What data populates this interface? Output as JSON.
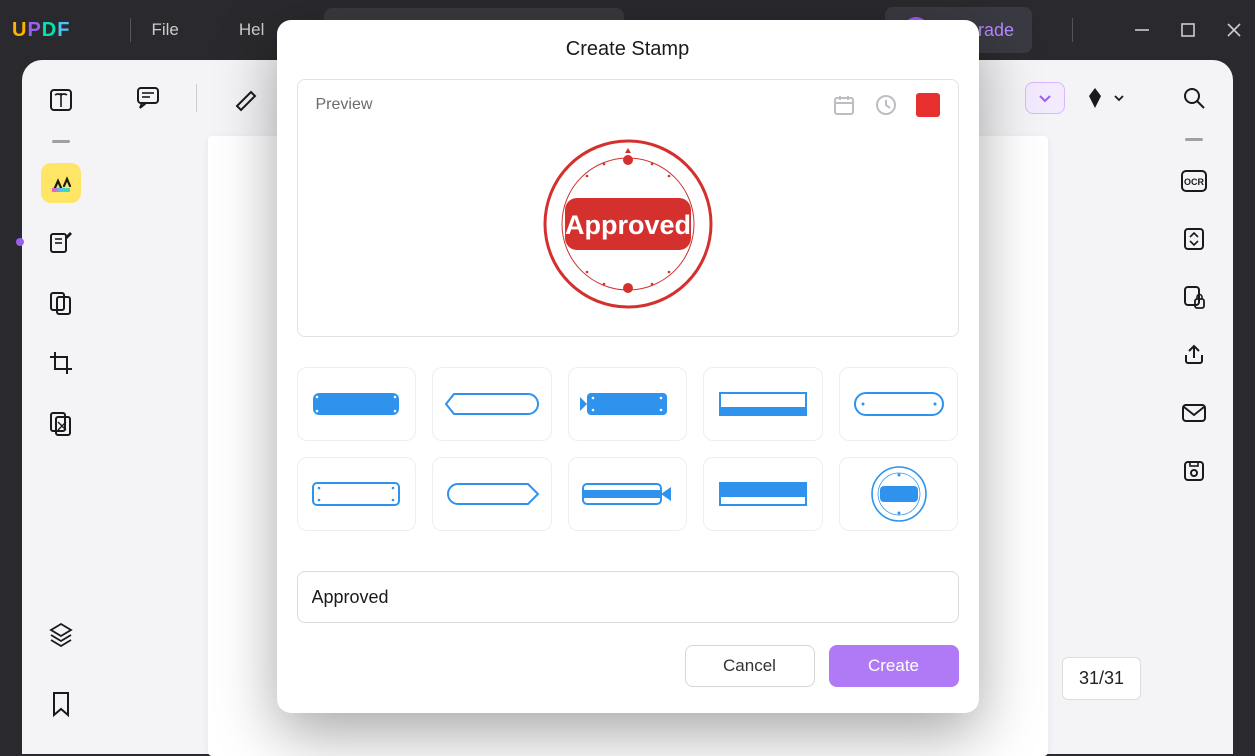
{
  "titlebar": {
    "menu_file": "File",
    "menu_help": "Hel",
    "upgrade_label": "Upgrade",
    "upgrade_badge": "U",
    "upgrade_visible_text": "rade"
  },
  "dialog": {
    "title": "Create Stamp",
    "preview_label": "Preview",
    "stamp_text": "Approved",
    "input_value": "Approved",
    "cancel_label": "Cancel",
    "create_label": "Create",
    "swatch_color": "#e8312f"
  },
  "page_indicator": "31/31",
  "icons": {
    "search": "search-icon",
    "ocr": "ocr-icon",
    "convert": "convert-icon",
    "lock": "lock-icon",
    "share": "share-icon",
    "mail": "mail-icon",
    "save": "save-icon"
  }
}
